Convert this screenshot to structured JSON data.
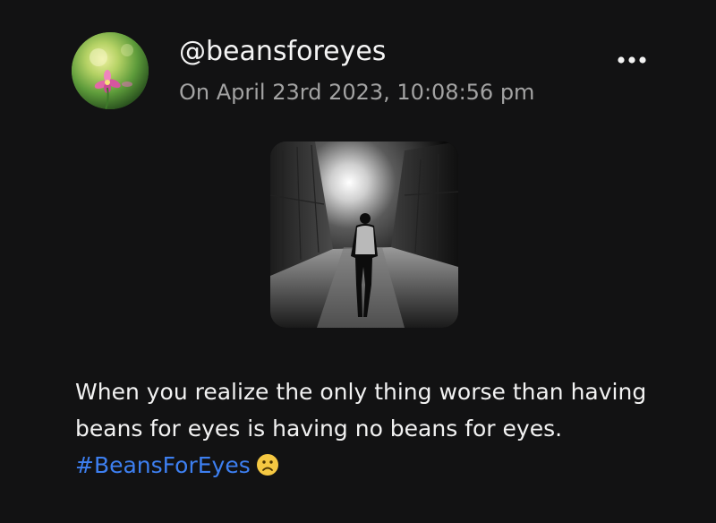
{
  "post": {
    "username": "@beansforeyes",
    "timestamp": "On April 23rd 2023, 10:08:56 pm",
    "body_text": "When you realize the only thing worse than having beans for eyes is having no beans for eyes.",
    "hashtag": "#BeansForEyes",
    "emoji": "frowning-face",
    "more_icon": "more-horizontal-icon",
    "avatar_icon": "flower-avatar-icon",
    "media_description_icon": "man-in-dark-alley-photo"
  },
  "colors": {
    "background": "#121213",
    "text": "#f2f2f2",
    "muted": "#a3a3a3",
    "hashtag": "#3d7ff0",
    "emoji": "#f5c842"
  }
}
